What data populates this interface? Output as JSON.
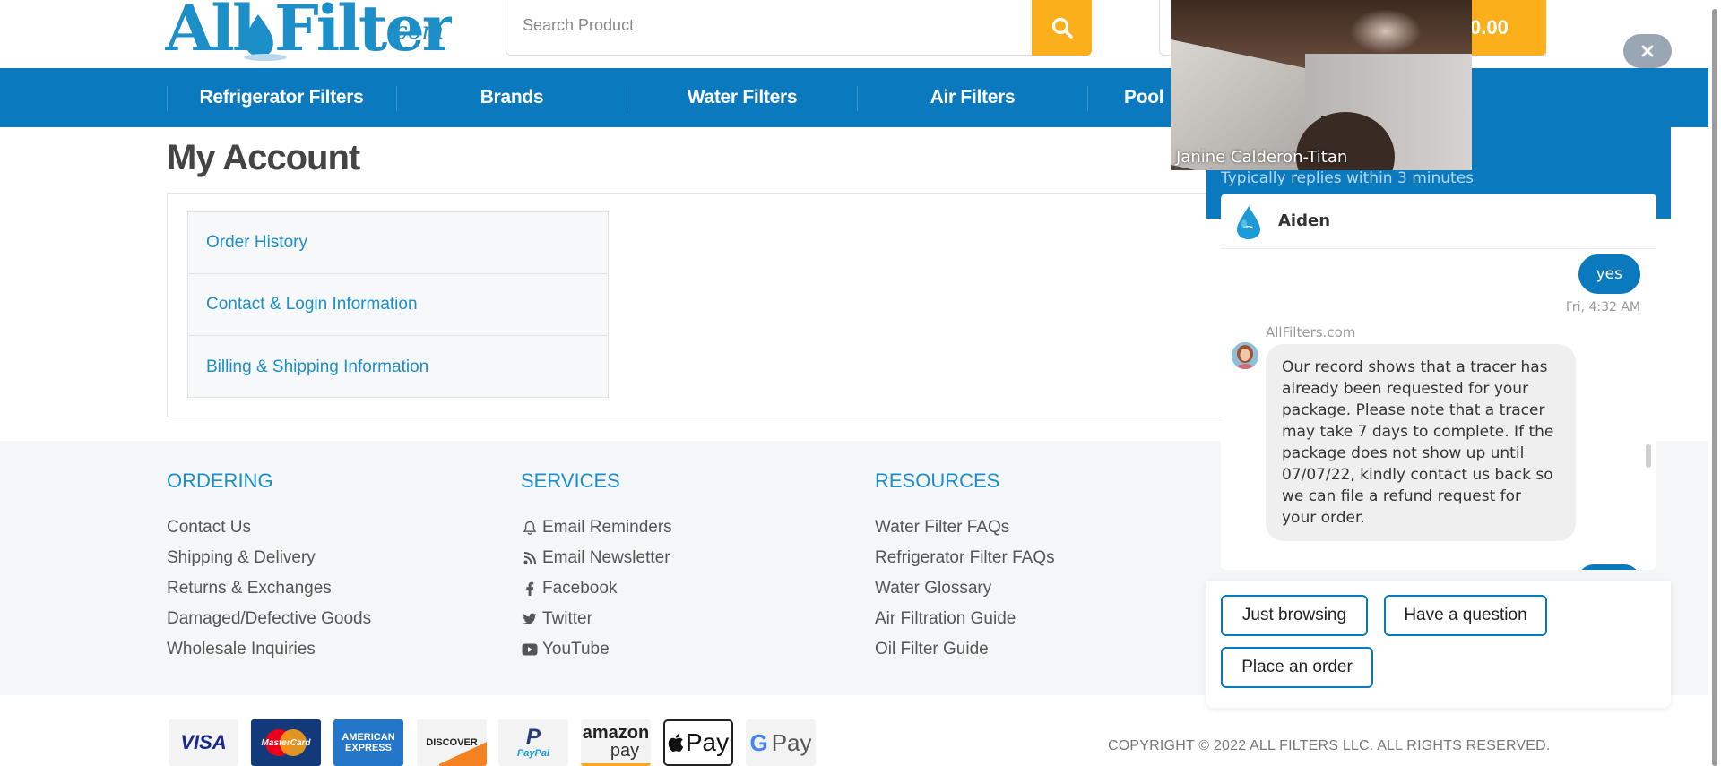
{
  "brand": {
    "logo_text": "All Filters",
    "logo_domain": ".com",
    "accent": "#0a79be",
    "link": "#1c8fc9",
    "cta": "#fbb01b"
  },
  "search": {
    "placeholder": "Search Product"
  },
  "cart": {
    "total": "0.00"
  },
  "nav": {
    "items": [
      {
        "label": "Refrigerator Filters"
      },
      {
        "label": "Brands"
      },
      {
        "label": "Water Filters"
      },
      {
        "label": "Air Filters"
      },
      {
        "label": "Pool"
      }
    ]
  },
  "account": {
    "title": "My Account",
    "links": [
      {
        "label": "Order History"
      },
      {
        "label": "Contact & Login Information"
      },
      {
        "label": "Billing & Shipping Information"
      }
    ]
  },
  "footer": {
    "ordering": {
      "heading": "ORDERING",
      "items": [
        "Contact Us",
        "Shipping & Delivery",
        "Returns & Exchanges",
        "Damaged/Defective Goods",
        "Wholesale Inquiries"
      ]
    },
    "services": {
      "heading": "SERVICES",
      "items": [
        {
          "label": "Email Reminders",
          "icon": "bell-icon"
        },
        {
          "label": "Email Newsletter",
          "icon": "rss-icon"
        },
        {
          "label": "Facebook",
          "icon": "facebook-icon"
        },
        {
          "label": "Twitter",
          "icon": "twitter-icon"
        },
        {
          "label": "YouTube",
          "icon": "youtube-icon"
        }
      ]
    },
    "resources": {
      "heading": "RESOURCES",
      "items": [
        "Water Filter FAQs",
        "Refrigerator Filter FAQs",
        "Water Glossary",
        "Air Filtration Guide",
        "Oil Filter Guide"
      ]
    },
    "payments": {
      "visa": "VISA",
      "mastercard": "MasterCard",
      "amex_line1": "AMERICAN",
      "amex_line2": "EXPRESS",
      "discover": "DISCOVER",
      "paypal_p": "P",
      "paypal": "PayPal",
      "amazon": "amazon",
      "amazon_pay": "pay",
      "applepay": "Pay",
      "googlepay_g": "G",
      "googlepay": "Pay"
    },
    "copyright": "COPYRIGHT © 2022 ALL FILTERS LLC. ALL RIGHTS RESERVED."
  },
  "chat": {
    "replies_note": "Typically replies within 3 minutes",
    "agent_name": "Aiden",
    "user_message": "yes",
    "user_message_time": "Fri, 4:32 AM",
    "bot_sender": "AllFilters.com",
    "bot_message": "Our record shows that a tracer has already been requested for your package. Please note that a tracer may take 7 days to complete. If the package does not show up until 07/07/22, kindly contact us back so we can file a refund request for your order.",
    "options": [
      "Just browsing",
      "Have a question",
      "Place an order"
    ],
    "close_label": "×"
  },
  "video": {
    "participant": "Janine Calderon-Titan"
  }
}
